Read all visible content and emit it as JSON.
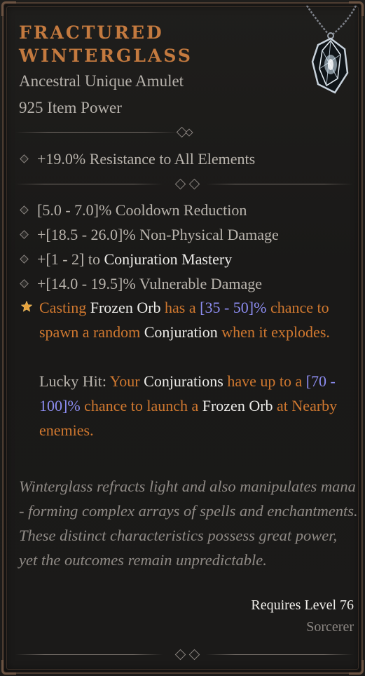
{
  "item": {
    "name_line1": "Fractured",
    "name_line2": "Winterglass",
    "type": "Ancestral Unique Amulet",
    "item_power": "925 Item Power",
    "icon": "amulet-icon"
  },
  "implicit": {
    "text": "+19.0% Resistance to All Elements"
  },
  "affixes": [
    {
      "text": "[5.0 - 7.0]% Cooldown Reduction"
    },
    {
      "pre": "+[1 - 2] to ",
      "hl": "Conjuration Mastery"
    },
    {
      "text": "+[18.5 - 26.0]% Non-Physical Damage"
    },
    {
      "text": "+[14.0 - 19.5]% Vulnerable Damage"
    }
  ],
  "unique_power": {
    "p1_a": "Casting ",
    "p1_b": "Frozen Orb",
    "p1_c": " has a ",
    "p1_d": "[35 - 50]%",
    "p1_e": " chance to spawn a random ",
    "p1_f": "Conjuration",
    "p1_g": " when it explodes.",
    "p2_a": "Lucky Hit: ",
    "p2_b": "Your ",
    "p2_c": "Conjurations",
    "p2_d": " have up to a ",
    "p2_e": "[70 - 100]%",
    "p2_f": " chance to launch a ",
    "p2_g": "Frozen Orb",
    "p2_h": " at Nearby enemies."
  },
  "flavor": "Winterglass refracts light and also manipulates mana - forming complex arrays of spells and enchantments. These distinct characteristics possess great power, yet the outcomes remain unpredictable.",
  "requirements": {
    "level": "Requires Level 76",
    "class": "Sorcerer"
  },
  "colors": {
    "title": "#c47a3f",
    "unique_text": "#d0782f",
    "value_range": "#8c8cf0",
    "highlight": "#ecebe8",
    "flavor": "#8f8a85"
  }
}
